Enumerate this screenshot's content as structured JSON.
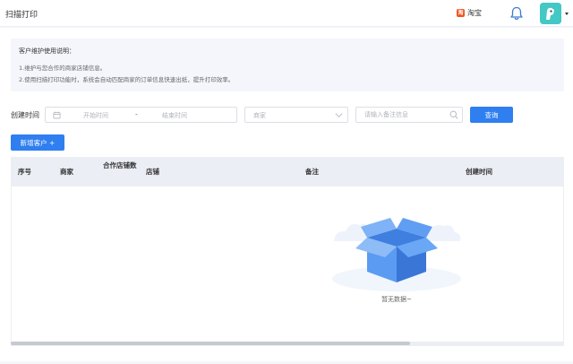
{
  "header": {
    "app_title": "扫描打印",
    "platform_label": "淘宝",
    "platform_logo_text": "淘"
  },
  "notice": {
    "title": "客户维护使用说明：",
    "lines": [
      "1.维护与您合作的商家店铺信息。",
      "2.使用扫描打印功能时，系统会自动匹配商家的订单信息快速出纸，提升打印效率。"
    ]
  },
  "filter": {
    "created_time_label": "创建时间",
    "start_placeholder": "开始时间",
    "separator": "-",
    "end_placeholder": "结束时间",
    "merchant_placeholder": "商家",
    "remark_placeholder": "请输入备注信息",
    "query_label": "查询"
  },
  "toolbar": {
    "add_customer_label": "新增客户 +"
  },
  "table": {
    "columns": [
      "序号",
      "商家",
      "合作店铺数",
      "店铺",
      "备注",
      "创建时间"
    ],
    "empty_text": "暂无数据~"
  },
  "colors": {
    "primary": "#2f7ff0",
    "taobao": "#f2541b",
    "avatar": "#43c8c6"
  },
  "icons": [
    "bell-icon",
    "calendar-icon",
    "chevron-down-icon",
    "search-icon",
    "empty-box-icon"
  ]
}
